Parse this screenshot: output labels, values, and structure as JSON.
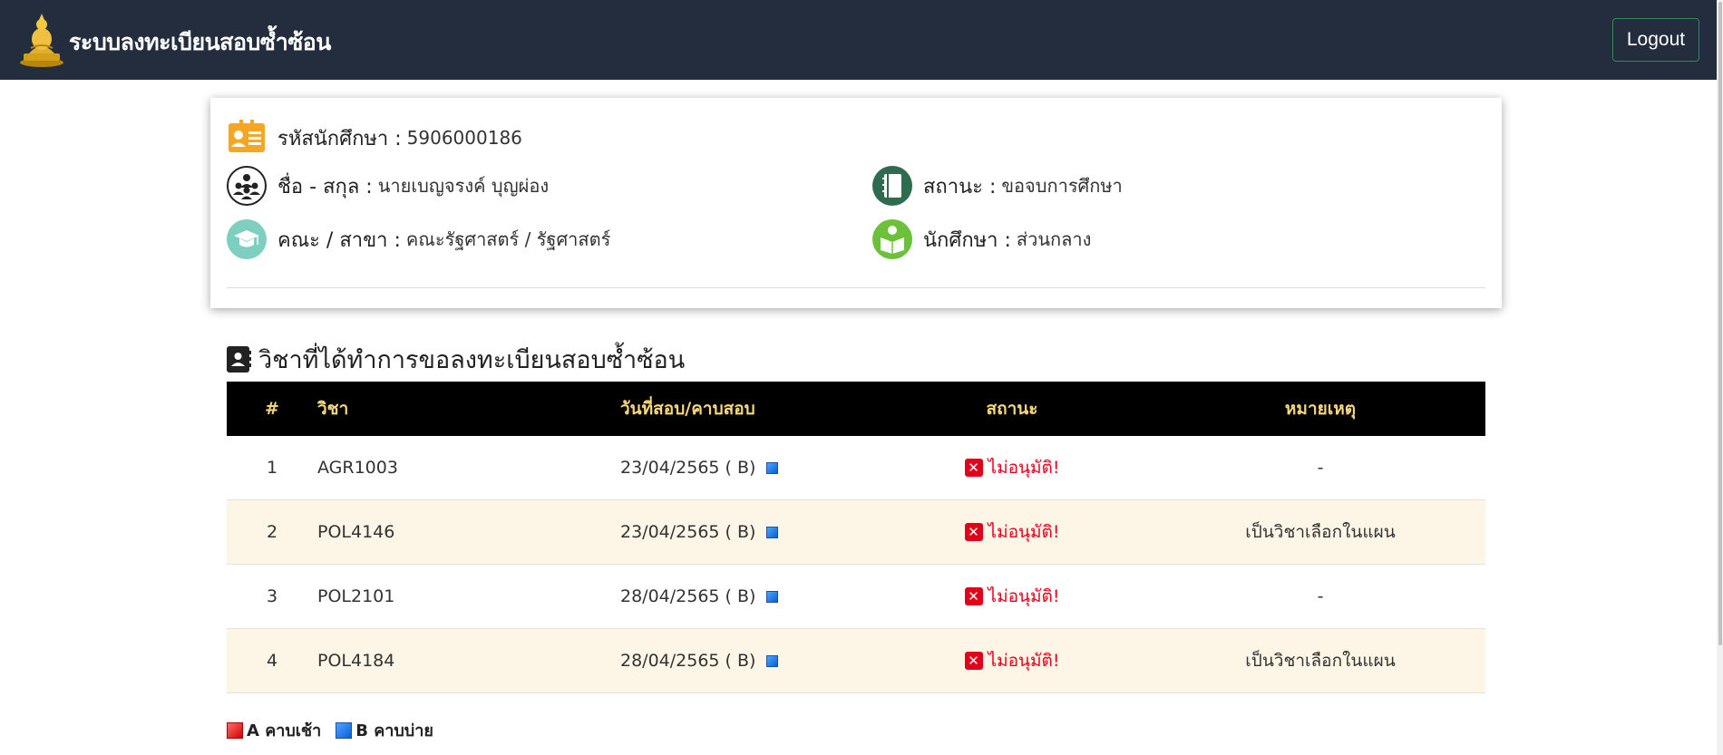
{
  "navbar": {
    "title": "ระบบลงทะเบียนสอบซ้ำซ้อน",
    "logout_label": "Logout"
  },
  "student": {
    "id_label": "รหัสนักศึกษา :",
    "id_value": "5906000186",
    "name_label": "ชื่อ - สกุล :",
    "name_value": "นายเบญจรงค์ บุญผ่อง",
    "faculty_label": "คณะ / สาขา :",
    "faculty_value": "คณะรัฐศาสตร์ / รัฐศาสตร์",
    "status_label": "สถานะ :",
    "status_value": "ขอจบการศึกษา",
    "type_label": "นักศึกษา :",
    "type_value": "ส่วนกลาง"
  },
  "section": {
    "title": "วิชาที่ได้ทำการขอลงทะเบียนสอบซ้ำซ้อน"
  },
  "table": {
    "headers": [
      "#",
      "วิชา",
      "วันที่สอบ/คาบสอบ",
      "สถานะ",
      "หมายเหตุ"
    ],
    "rows": [
      {
        "no": "1",
        "course": "AGR1003",
        "date": "23/04/2565 ( B)",
        "status": "ไม่อนุมัติ!",
        "note": "-"
      },
      {
        "no": "2",
        "course": "POL4146",
        "date": "23/04/2565 ( B)",
        "status": "ไม่อนุมัติ!",
        "note": "เป็นวิชาเลือกในแผน"
      },
      {
        "no": "3",
        "course": "POL2101",
        "date": "28/04/2565 ( B)",
        "status": "ไม่อนุมัติ!",
        "note": "-"
      },
      {
        "no": "4",
        "course": "POL4184",
        "date": "28/04/2565 ( B)",
        "status": "ไม่อนุมัติ!",
        "note": "เป็นวิชาเลือกในแผน"
      }
    ]
  },
  "legend": {
    "a_label": "A คาบเช้า",
    "b_label": "B คาบบ่าย"
  },
  "colors": {
    "navbar_bg": "#232d3e",
    "header_text": "#f6d77e",
    "status_red": "#e3001b",
    "row_alt_bg": "#fdf5e6"
  },
  "icons": {
    "brand": "temple-logo-icon",
    "id": "id-card-icon",
    "name": "people-group-icon",
    "faculty": "graduation-cap-icon",
    "status": "notebook-icon",
    "type": "student-reading-icon",
    "section": "address-book-icon",
    "reject": "x-square-icon",
    "period": "blue-square-icon"
  }
}
